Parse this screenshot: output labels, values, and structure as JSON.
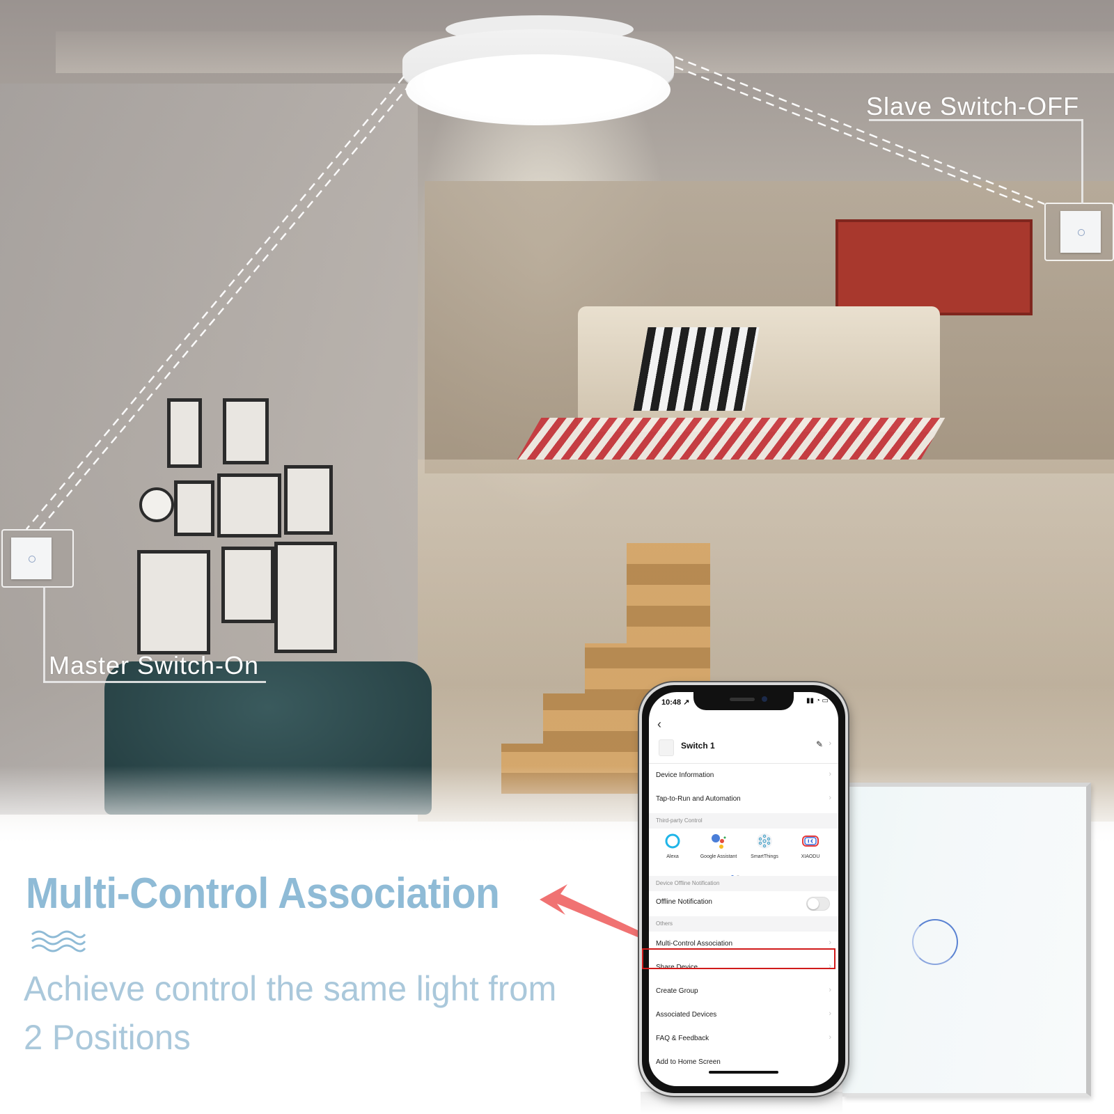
{
  "scene": {
    "labels": {
      "slave": "Slave Switch-OFF",
      "master": "Master Switch-On"
    },
    "headline": "Multi-Control Association",
    "subtitle_line1": "Achieve control the same light from",
    "subtitle_line2": "2 Positions",
    "colors": {
      "headline": "#8fbbd6",
      "subtitle": "#aac8db",
      "arrow": "#f07272",
      "highlight": "#d01a1a",
      "touch_ring": "#5a82d2"
    }
  },
  "phone": {
    "status": {
      "time": "10:48 ↗",
      "icons": "▮▮ ◔ ▭"
    },
    "back_icon": "chevron-left-icon",
    "device": {
      "name": "Switch 1",
      "edit_icon": "pencil-icon"
    },
    "rows_top": [
      {
        "label": "Device Information"
      },
      {
        "label": "Tap-to-Run and Automation"
      }
    ],
    "third_party": {
      "section_title": "Third-party Control",
      "items": [
        {
          "label": "Alexa",
          "icon": "alexa-icon"
        },
        {
          "label": "Google Assistant",
          "icon": "google-assistant-icon"
        },
        {
          "label": "SmartThings",
          "icon": "smartthings-icon"
        },
        {
          "label": "XIAODU",
          "icon": "xiaodu-icon"
        }
      ],
      "page_index": 1,
      "page_count": 2
    },
    "offline": {
      "section_title": "Device Offline Notification",
      "label": "Offline Notification",
      "enabled": false
    },
    "others": {
      "section_title": "Others",
      "items": [
        {
          "label": "Multi-Control Association",
          "highlighted": true
        },
        {
          "label": "Share Device"
        },
        {
          "label": "Create Group"
        },
        {
          "label": "Associated Devices"
        },
        {
          "label": "FAQ & Feedback"
        },
        {
          "label": "Add to Home Screen"
        }
      ]
    },
    "chevron": "›"
  }
}
